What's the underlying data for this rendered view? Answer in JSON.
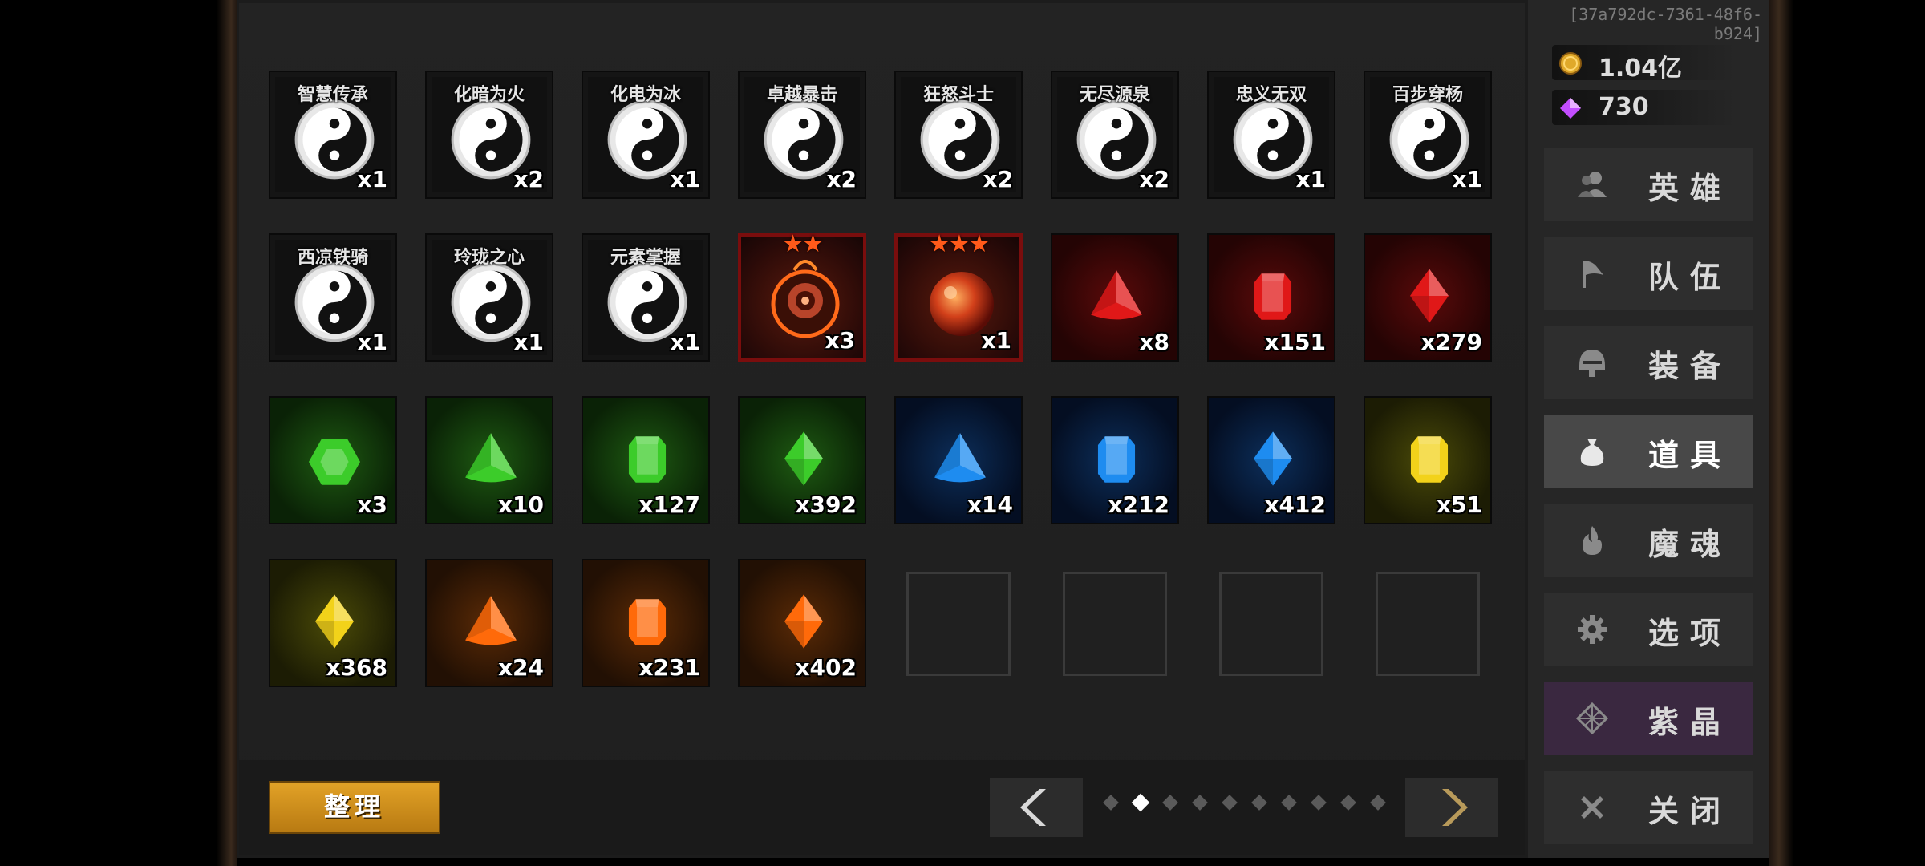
{
  "session_id": "[37a792dc-7361-48f6-b924]",
  "currency": {
    "gold": "1.04亿",
    "gems": "730",
    "gold_color": "#e0a92a",
    "gem_color": "#c34dff"
  },
  "menu": [
    {
      "label": "英雄",
      "icon": "heroes-icon"
    },
    {
      "label": "队伍",
      "icon": "flag-icon"
    },
    {
      "label": "装备",
      "icon": "helmet-icon"
    },
    {
      "label": "道具",
      "icon": "bag-icon",
      "active": true
    },
    {
      "label": "魔魂",
      "icon": "flame-icon"
    },
    {
      "label": "选项",
      "icon": "gear-icon"
    },
    {
      "label": "紫晶",
      "icon": "crystal-icon"
    },
    {
      "label": "关闭",
      "icon": "close-icon"
    }
  ],
  "inventory": {
    "row1": [
      {
        "name": "智慧传承",
        "qty": "x1"
      },
      {
        "name": "化暗为火",
        "qty": "x2"
      },
      {
        "name": "化电为冰",
        "qty": "x1"
      },
      {
        "name": "卓越暴击",
        "qty": "x2"
      },
      {
        "name": "狂怒斗士",
        "qty": "x2"
      },
      {
        "name": "无尽源泉",
        "qty": "x2"
      },
      {
        "name": "忠义无双",
        "qty": "x1"
      },
      {
        "name": "百步穿杨",
        "qty": "x1"
      }
    ],
    "row2": [
      {
        "name": "西凉铁骑",
        "qty": "x1"
      },
      {
        "name": "玲珑之心",
        "qty": "x1"
      },
      {
        "name": "元素掌握",
        "qty": "x1"
      },
      {
        "stars": "★★",
        "qty": "x3",
        "icon": "fire-eye-orb-icon"
      },
      {
        "stars": "★★★",
        "qty": "x1",
        "icon": "fire-orb-icon"
      },
      {
        "qty": "x8",
        "icon": "red-trillion-gem-icon"
      },
      {
        "qty": "x151",
        "icon": "red-emerald-gem-icon"
      },
      {
        "qty": "x279",
        "icon": "red-marquise-gem-icon"
      }
    ],
    "row3": [
      {
        "qty": "x3",
        "icon": "green-hexagon-gem-icon"
      },
      {
        "qty": "x10",
        "icon": "green-trillion-gem-icon"
      },
      {
        "qty": "x127",
        "icon": "green-emerald-gem-icon"
      },
      {
        "qty": "x392",
        "icon": "green-marquise-gem-icon"
      },
      {
        "qty": "x14",
        "icon": "blue-trillion-gem-icon"
      },
      {
        "qty": "x212",
        "icon": "blue-emerald-gem-icon"
      },
      {
        "qty": "x412",
        "icon": "blue-marquise-gem-icon"
      },
      {
        "qty": "x51",
        "icon": "yellow-emerald-gem-icon"
      }
    ],
    "row4": [
      {
        "qty": "x368",
        "icon": "yellow-marquise-gem-icon"
      },
      {
        "qty": "x24",
        "icon": "orange-trillion-gem-icon"
      },
      {
        "qty": "x231",
        "icon": "orange-emerald-gem-icon"
      },
      {
        "qty": "x402",
        "icon": "orange-marquise-gem-icon"
      }
    ]
  },
  "sort_label": "整理",
  "pagination": {
    "current": 2,
    "total": 10
  }
}
